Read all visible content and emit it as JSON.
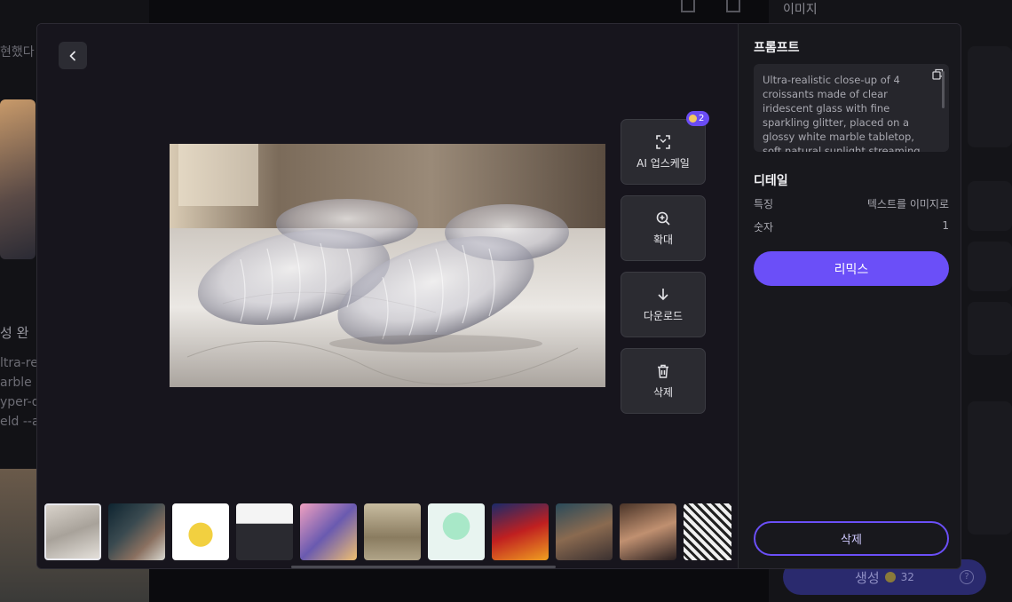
{
  "background": {
    "fragment_1": "현했다",
    "fragment_2": "성 완",
    "fragment_3": "ltra-re",
    "fragment_4": "arble",
    "fragment_5": "yper-d",
    "fragment_6": "eld --a",
    "right_title": "이미지",
    "generate_label": "생성",
    "generate_cost": "32",
    "help_glyph": "?"
  },
  "viewer": {
    "back_icon": "chevron-left-icon",
    "main_image_alt": "Glass croissants on marble tabletop",
    "actions": [
      {
        "label": "AI 업스케일",
        "icon": "expand-icon",
        "badge": "2"
      },
      {
        "label": "확대",
        "icon": "zoom-in-icon"
      },
      {
        "label": "다운로드",
        "icon": "download-icon"
      },
      {
        "label": "삭제",
        "icon": "trash-icon"
      }
    ],
    "thumbnail_count": 11,
    "selected_thumbnail": 0
  },
  "panel": {
    "prompt_heading": "프롬프트",
    "prompt_text": "Ultra-realistic close-up of 4 croissants made of clear iridescent glass with fine sparkling glitter, placed on a glossy white marble tabletop, soft natural sunlight streaming from the left side",
    "details_heading": "디테일",
    "details": [
      {
        "label": "특징",
        "value": "텍스트를 이미지로"
      },
      {
        "label": "숫자",
        "value": "1"
      }
    ],
    "remix_label": "리믹스",
    "delete_label": "삭제"
  },
  "colors": {
    "accent": "#6b4ff8",
    "modal_bg": "#17151d",
    "panel_bg": "#18181d"
  }
}
